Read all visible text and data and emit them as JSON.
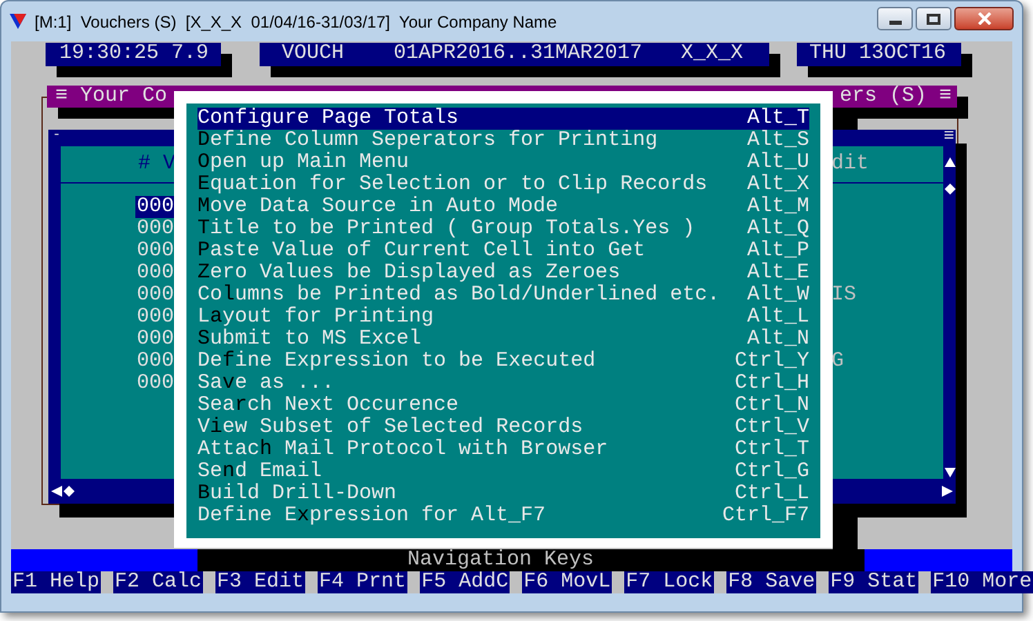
{
  "window": {
    "title": "[M:1]  Vouchers (S)  [X_X_X  01/04/16-31/03/17]  Your Company Name"
  },
  "info_bar": {
    "time": "19:30:25 7.9",
    "module": "VOUCH",
    "period": "01APR2016..31MAR2017",
    "company_code": "X_X_X",
    "date": "THU 13OCT16"
  },
  "background_window": {
    "title_left": "≡ Your Co",
    "title_right": "ers (S) ≡",
    "corner_mark": "-",
    "menu_mark": "≡",
    "header_left": "# V",
    "header_right": "dit",
    "rows": [
      {
        "cell": "000",
        "end_text": "",
        "selected": true
      },
      {
        "cell": "000",
        "end_text": "",
        "selected": false
      },
      {
        "cell": "000",
        "end_text": "",
        "selected": false
      },
      {
        "cell": "000",
        "end_text": "",
        "selected": false
      },
      {
        "cell": "000",
        "end_text": "IS",
        "selected": false
      },
      {
        "cell": "000",
        "end_text": "",
        "selected": false
      },
      {
        "cell": "000",
        "end_text": "",
        "selected": false
      },
      {
        "cell": "000",
        "end_text": "G",
        "selected": false
      },
      {
        "cell": "000",
        "end_text": "",
        "selected": false
      }
    ]
  },
  "popup_menu": {
    "items": [
      {
        "label": "Configure Page Totals",
        "shortcut": "Alt_T",
        "selected": true
      },
      {
        "label": "**D**efine Column Seperators for Printing",
        "shortcut": "Alt_S",
        "selected": false
      },
      {
        "label": "**O**pen up Main Menu",
        "shortcut": "Alt_U",
        "selected": false
      },
      {
        "label": "**E**quation for Selection or to Clip Records",
        "shortcut": "Alt_X",
        "selected": false
      },
      {
        "label": "**M**ove Data Source in Auto Mode",
        "shortcut": "Alt_M",
        "selected": false
      },
      {
        "label": "**T**itle to be Printed ( Group Totals.Yes )",
        "shortcut": "Alt_Q",
        "selected": false
      },
      {
        "label": "**P**aste Value of Current Cell into Get",
        "shortcut": "Alt_P",
        "selected": false
      },
      {
        "label": "**Z**ero Values be Displayed as Zeroes",
        "shortcut": "Alt_E",
        "selected": false
      },
      {
        "label": "Co**l**umns be Printed as Bold/Underlined etc.",
        "shortcut": "Alt_W",
        "selected": false
      },
      {
        "label": "L**a**yout for Printing",
        "shortcut": "Alt_L",
        "selected": false
      },
      {
        "label": "**S**ubmit to MS Excel",
        "shortcut": "Alt_N",
        "selected": false
      },
      {
        "label": "De**f**ine Expression to be Executed",
        "shortcut": "Ctrl_Y",
        "selected": false
      },
      {
        "label": "Sa**v**e as ...",
        "shortcut": "Ctrl_H",
        "selected": false
      },
      {
        "label": "Sea**r**ch Next Occurence",
        "shortcut": "Ctrl_N",
        "selected": false
      },
      {
        "label": "V**i**ew Subset of Selected Records",
        "shortcut": "Ctrl_V",
        "selected": false
      },
      {
        "label": "Attac**h** Mail Protocol with Browser",
        "shortcut": "Ctrl_T",
        "selected": false
      },
      {
        "label": "Se**n**d Email",
        "shortcut": "Ctrl_G",
        "selected": false
      },
      {
        "label": "**B**uild Drill-Down",
        "shortcut": "Ctrl_L",
        "selected": false
      },
      {
        "label": "Define E**x**pression for Alt_F7",
        "shortcut": "Ctrl_F7",
        "selected": false
      }
    ]
  },
  "status_bar": {
    "title": "Navigation Keys",
    "keys": [
      {
        "key": "F1",
        "label": "Help"
      },
      {
        "key": "F2",
        "label": "Calc"
      },
      {
        "key": "F3",
        "label": "Edit"
      },
      {
        "key": "F4",
        "label": "Prnt"
      },
      {
        "key": "F5",
        "label": "AddC"
      },
      {
        "key": "F6",
        "label": "MovL"
      },
      {
        "key": "F7",
        "label": "Lock"
      },
      {
        "key": "F8",
        "label": "Save"
      },
      {
        "key": "F9",
        "label": "Stat"
      },
      {
        "key": "F10",
        "label": "More"
      }
    ]
  }
}
